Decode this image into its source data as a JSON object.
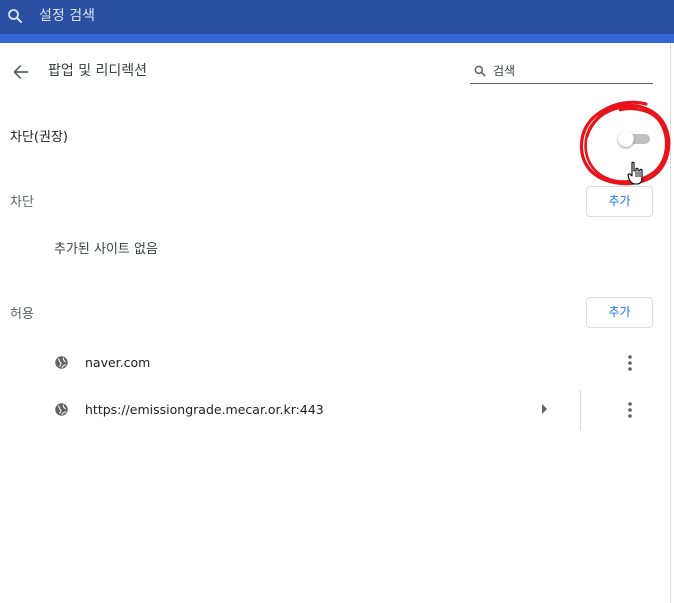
{
  "topbar": {
    "search_placeholder": "설정 검색",
    "icon": "search-icon",
    "color": "#2a4fa3"
  },
  "subpage": {
    "back_icon": "arrow-back-icon",
    "title": "팝업 및 리디렉션",
    "search_placeholder": "검색",
    "search_icon": "search-icon"
  },
  "main_toggle": {
    "label": "차단(권장)",
    "checked": false
  },
  "annotation": {
    "type": "red-hand-drawn-circle",
    "color": "#e8141b",
    "cursor": "hand-pointer-cursor"
  },
  "block_section": {
    "heading": "차단",
    "add_label": "추가",
    "empty_message": "추가된 사이트 없음"
  },
  "allow_section": {
    "heading": "허용",
    "add_label": "추가",
    "sites": [
      {
        "icon": "globe-icon",
        "url": "naver.com",
        "has_arrow": false,
        "menu_icon": "more-vert-icon"
      },
      {
        "icon": "globe-icon",
        "url": "https://emissiongrade.mecar.or.kr:443",
        "has_arrow": true,
        "menu_icon": "more-vert-icon"
      }
    ]
  },
  "colors": {
    "accent": "#1a73e8",
    "toggle_track": "#bdc1c6"
  }
}
